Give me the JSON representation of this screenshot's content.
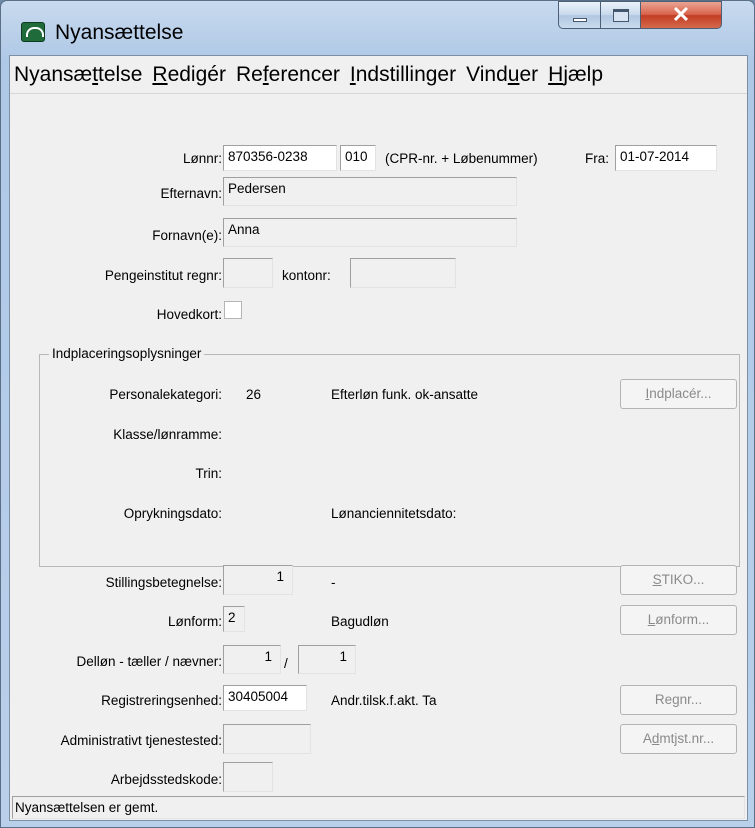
{
  "window": {
    "title": "Nyansættelse"
  },
  "menu": {
    "items": [
      {
        "pre": "Nyansæ",
        "key": "t",
        "post": "telse"
      },
      {
        "pre": "",
        "key": "R",
        "post": "edigér"
      },
      {
        "pre": "Re",
        "key": "f",
        "post": "erencer"
      },
      {
        "pre": "",
        "key": "I",
        "post": "ndstillinger"
      },
      {
        "pre": "Vind",
        "key": "u",
        "post": "er"
      },
      {
        "pre": "",
        "key": "H",
        "post": "jælp"
      }
    ]
  },
  "form": {
    "lonnr_label": "Lønnr:",
    "lonnr_value": "870356-0238",
    "lobenummer_value": "010",
    "lonnr_hint": "(CPR-nr. + Løbenummer)",
    "fra_label": "Fra:",
    "fra_value": "01-07-2014",
    "efternavn_label": "Efternavn:",
    "efternavn_value": "Pedersen",
    "fornavn_label": "Fornavn(e):",
    "fornavn_value": "Anna",
    "regnr_label": "Pengeinstitut regnr:",
    "regnr_value": "",
    "kontonr_label": "kontonr:",
    "kontonr_value": "",
    "hovedkort_label": "Hovedkort:"
  },
  "placement": {
    "title": "Indplaceringsoplysninger",
    "personalekategori_label": "Personalekategori:",
    "personalekategori_code": "26",
    "personalekategori_text": "Efterløn funk. ok-ansatte",
    "klasse_label": "Klasse/lønramme:",
    "trin_label": "Trin:",
    "oprykningsdato_label": "Oprykningsdato:",
    "lonanciennitet_label": "Lønanciennitetsdato:",
    "indplacer_button": {
      "pre": "",
      "key": "I",
      "post": "ndplacér..."
    }
  },
  "employment": {
    "stilling_label": "Stillingsbetegnelse:",
    "stilling_value": "1",
    "stilling_text": "-",
    "lonform_label": "Lønform:",
    "lonform_value": "2",
    "lonform_text": "Bagudløn",
    "dellon_label": "Delløn - tæller / nævner:",
    "taeller_value": "1",
    "slash": "/",
    "naevner_value": "1",
    "reg_label": "Registreringsenhed:",
    "reg_value": "30405004",
    "reg_text": "Andr.tilsk.f.akt. Ta",
    "admin_label": "Administrativt tjenestested:",
    "admin_value": "",
    "arbejdssted_label": "Arbejdsstedskode:",
    "arbejdssted_value": "",
    "stiko_button": {
      "pre": "",
      "key": "S",
      "post": "TIKO..."
    },
    "lonform_button": {
      "pre": "",
      "key": "L",
      "post": "ønform..."
    },
    "regnr_button": {
      "pre": "Re",
      "key": "g",
      "post": "nr..."
    },
    "admtjst_button": {
      "pre": "A",
      "key": "d",
      "post": "mtjst.nr..."
    }
  },
  "status": {
    "text": "Nyansættelsen er gemt."
  }
}
